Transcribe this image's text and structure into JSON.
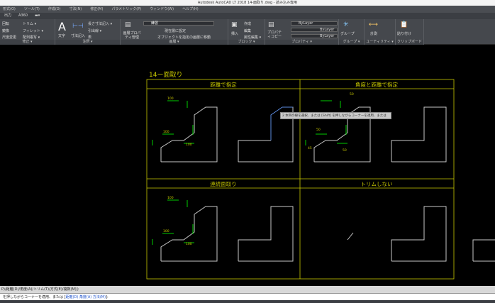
{
  "window": {
    "title": "Autodesk AutoCAD LT 2018    14-面取り.dwg - 読み込み専用"
  },
  "menu": [
    "形式(O)",
    "ツール(T)",
    "作成(D)",
    "寸法(N)",
    "修正(M)",
    "パラメトリック(P)",
    "ウィンドウ(W)",
    "ヘルプ(H)"
  ],
  "tabs": [
    "出力",
    "A360"
  ],
  "ribbon": {
    "modify": {
      "label": "修正 ▾",
      "items": [
        "回転",
        "鏡像",
        "尺度変更",
        "トリム ▾",
        "フィレット ▾",
        "配列複写 ▾"
      ]
    },
    "annotation": {
      "label": "注釈 ▾",
      "text": "文字",
      "dim": "寸法記入",
      "items": [
        "長さ寸法記入 ▾",
        "引出線 ▾",
        "表"
      ]
    },
    "layers": {
      "label": "画層 ▾",
      "props": "画層プロパティ管理",
      "layer_value": "練習",
      "items": [
        "現在層に設定",
        "オブジェクトを指定の画層に移動"
      ]
    },
    "block": {
      "label": "ブロック ▾",
      "insert": "挿入",
      "items": [
        "作成",
        "編集",
        "属性編集 ▾"
      ]
    },
    "properties": {
      "label": "プロパティ ▾",
      "copy": "プロパティコピー",
      "color": "ByLayer",
      "linetype": "ByLayer",
      "lineweight": "ByLayer"
    },
    "groups": {
      "label": "グループ ▾",
      "group": "グループ"
    },
    "utilities": {
      "label": "ユーティリティ ▾",
      "measure": "計測"
    },
    "clipboard": {
      "label": "クリップボード",
      "paste": "貼り付け"
    }
  },
  "drawing": {
    "title": "14ー面取り",
    "sections": [
      "距離で指定",
      "角度と距離で指定",
      "連続面取り",
      "トリムしない"
    ],
    "dims": {
      "d100": "100",
      "d50": "50",
      "d45": "45",
      "d20": "20"
    },
    "tooltip": "2 本目の線を選択、または [Shift] を押しながらコーナーを適用、または",
    "colors": {
      "frame": "#c8c800",
      "shape": "#c8c8c8",
      "dim": "#00cc00",
      "selected": "#5b8be0"
    }
  },
  "command": {
    "history": "P)/距離(D)/角度(A)/トリム(T)/方式(E)/複数(M)]:",
    "prompt": "を押しながらコーナーを適用、または [",
    "opt1": "距離(D)",
    "opt2": "角度(A)",
    "opt3": "方法(M)",
    "end": "]:"
  }
}
